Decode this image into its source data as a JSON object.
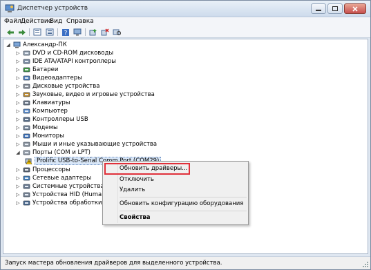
{
  "window": {
    "title": "Диспетчер устройств"
  },
  "menu": {
    "items": [
      "Файл",
      "Действие",
      "Вид",
      "Справка"
    ]
  },
  "toolbar": {
    "icons": [
      "back-arrow-icon",
      "forward-arrow-icon",
      "properties-icon",
      "list-view-icon",
      "help-icon",
      "devices-view-icon",
      "update-driver-icon",
      "uninstall-icon",
      "scan-hardware-icon"
    ]
  },
  "tree": {
    "root": "Александр-ПК",
    "categories": [
      {
        "label": "DVD и CD-ROM дисководы",
        "icon": "dvd-drive-icon"
      },
      {
        "label": "IDE ATA/ATAPI контроллеры",
        "icon": "ide-controller-icon"
      },
      {
        "label": "Батареи",
        "icon": "battery-icon"
      },
      {
        "label": "Видеоадаптеры",
        "icon": "display-adapter-icon"
      },
      {
        "label": "Дисковые устройства",
        "icon": "disk-drive-icon"
      },
      {
        "label": "Звуковые, видео и игровые устройства",
        "icon": "sound-device-icon"
      },
      {
        "label": "Клавиатуры",
        "icon": "keyboard-icon"
      },
      {
        "label": "Компьютер",
        "icon": "computer-icon"
      },
      {
        "label": "Контроллеры USB",
        "icon": "usb-controller-icon"
      },
      {
        "label": "Модемы",
        "icon": "modem-icon"
      },
      {
        "label": "Мониторы",
        "icon": "monitor-icon"
      },
      {
        "label": "Мыши и иные указывающие устройства",
        "icon": "mouse-icon"
      },
      {
        "label": "Порты (COM и LPT)",
        "icon": "port-icon"
      }
    ],
    "selected_child": {
      "label": "Prolific USB-to-Serial Comm Port (COM29)",
      "icon": "warning-port-icon"
    },
    "after": [
      {
        "label": "Процессоры",
        "icon": "processor-icon"
      },
      {
        "label": "Сетевые адаптеры",
        "icon": "network-adapter-icon"
      },
      {
        "label": "Системные устройства",
        "icon": "system-device-icon"
      },
      {
        "label": "Устройства HID (Human Im",
        "icon": "hid-device-icon"
      },
      {
        "label": "Устройства обработки изо",
        "icon": "imaging-device-icon"
      }
    ]
  },
  "context_menu": {
    "items": [
      {
        "label": "Обновить драйверы...",
        "highlighted": true
      },
      {
        "label": "Отключить"
      },
      {
        "label": "Удалить"
      },
      {
        "label": "Обновить конфигурацию оборудования"
      },
      {
        "label": "Свойства",
        "bold": true
      }
    ],
    "highlight_color": "#e0303a"
  },
  "status": {
    "text": "Запуск мастера обновления драйверов для выделенного устройства."
  },
  "colors": {
    "title_gradient_top": "#e9f0f8",
    "title_gradient_bottom": "#cddbec",
    "selection": "#d9e7f8"
  }
}
